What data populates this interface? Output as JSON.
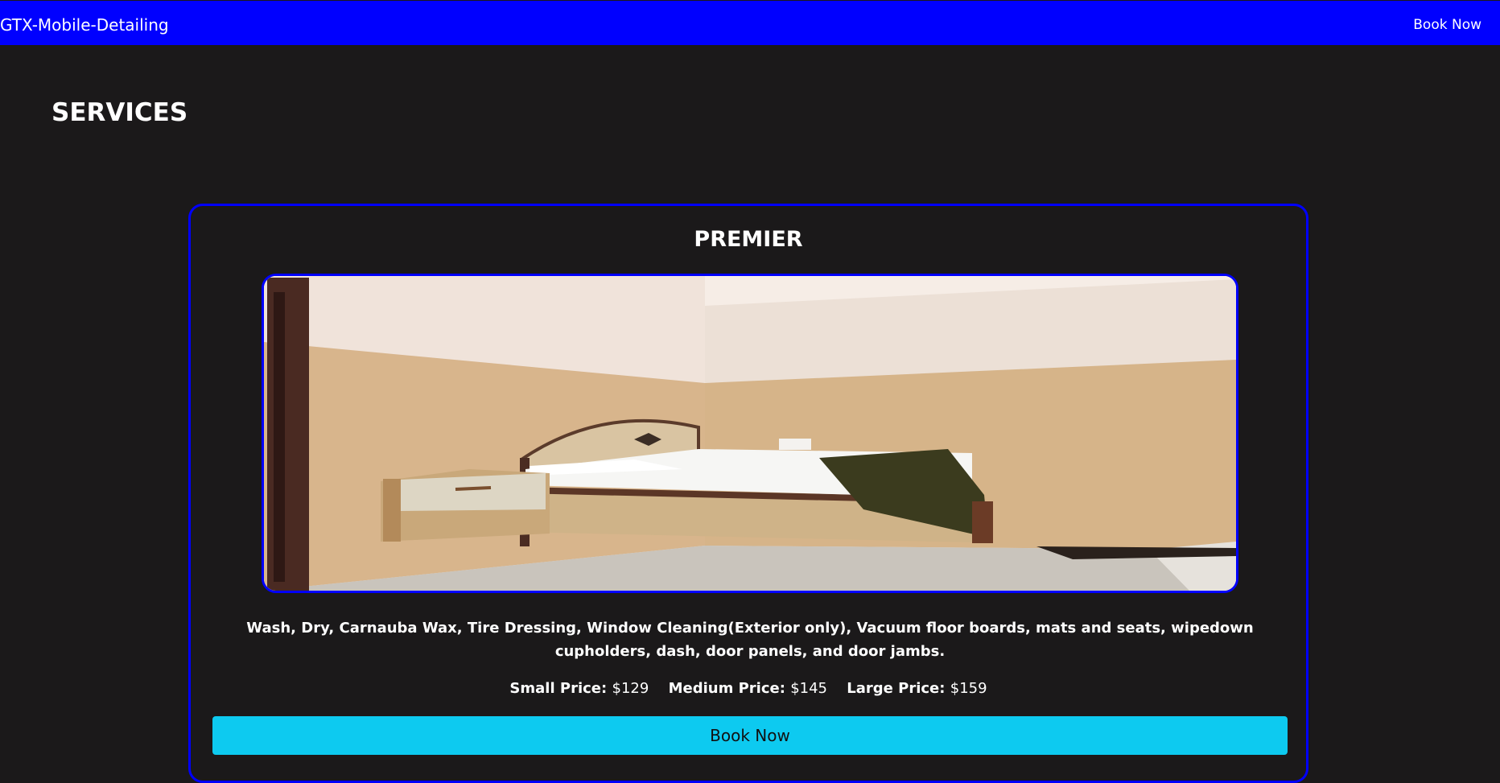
{
  "navbar": {
    "brand": "GTX-Mobile-Detailing",
    "book_now": "Book Now"
  },
  "page": {
    "title": "SERVICES"
  },
  "service": {
    "name": "PREMIER",
    "image_subject": "bedroom photo",
    "description": "Wash, Dry, Carnauba Wax, Tire Dressing, Window Cleaning(Exterior only), Vacuum floor boards, mats and seats, wipedown cupholders, dash, door panels, and door jambs.",
    "prices": [
      {
        "label": "Small Price:",
        "value": "$129"
      },
      {
        "label": "Medium Price:",
        "value": "$145"
      },
      {
        "label": "Large Price:",
        "value": "$159"
      }
    ],
    "book_button": "Book Now"
  },
  "colors": {
    "navbar": "#0000ff",
    "background": "#1b191a",
    "card_border": "#0000ff",
    "button": "#0dcaf0"
  }
}
